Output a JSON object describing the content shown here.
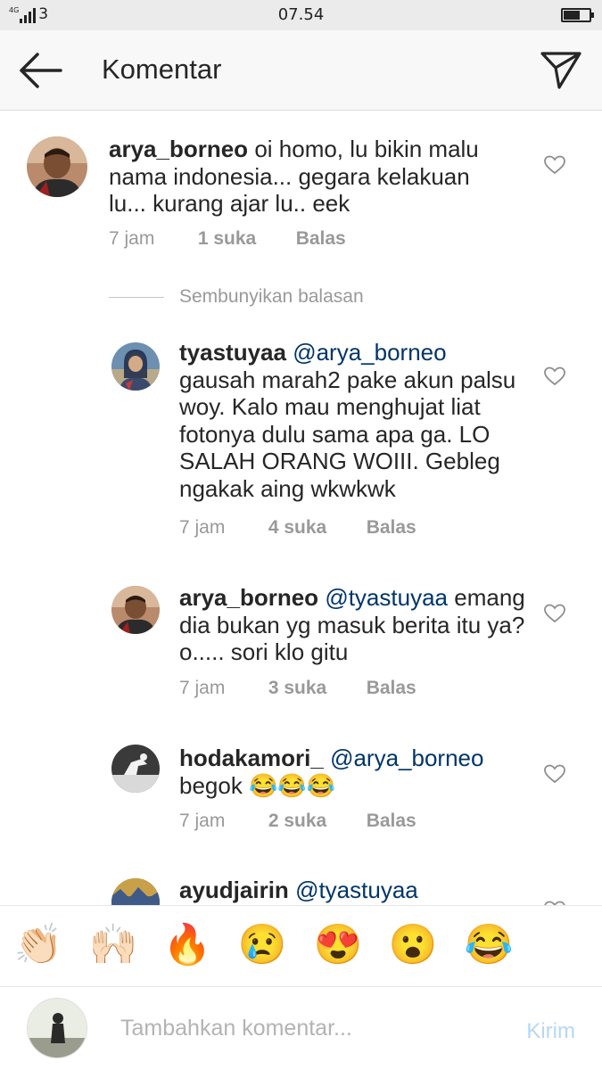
{
  "status_bar": {
    "network": "4G",
    "carrier_slot": "3",
    "time": "07.54"
  },
  "header": {
    "title": "Komentar",
    "back_icon": "arrow-left-icon",
    "send_icon": "paper-plane-icon"
  },
  "comments": [
    {
      "username": "arya_borneo",
      "mention": "",
      "text": "oi homo, lu bikin malu nama indonesia... gegara kelakuan lu... kurang ajar lu.. eek",
      "time": "7 jam",
      "likes": "1 suka",
      "reply": "Balas"
    }
  ],
  "hide_replies": "Sembunyikan balasan",
  "replies": [
    {
      "username": "tyastuyaa",
      "mention": "@arya_borneo",
      "text": "gausah marah2 pake akun palsu woy. Kalo mau menghujat liat fotonya dulu sama apa ga. LO SALAH ORANG WOIII. Gebleg ngakak aing wkwkwk",
      "time": "7 jam",
      "likes": "4 suka",
      "reply": "Balas"
    },
    {
      "username": "arya_borneo",
      "mention": "@tyastuyaa",
      "text": "emang dia bukan yg masuk berita itu ya? o..... sori klo gitu",
      "time": "7 jam",
      "likes": "3 suka",
      "reply": "Balas"
    },
    {
      "username": "hodakamori_",
      "mention": "@arya_borneo",
      "text": "begok 😂😂😂",
      "time": "7 jam",
      "likes": "2 suka",
      "reply": "Balas"
    },
    {
      "username": "ayudjairin",
      "mention": "@tyastuyaa",
      "text": "",
      "time": "",
      "likes": "",
      "reply": ""
    }
  ],
  "emoji_bar": [
    "👏🏻",
    "🙌🏻",
    "🔥",
    "😢",
    "😍",
    "😮",
    "😂"
  ],
  "composer": {
    "placeholder": "Tambahkan komentar...",
    "post_label": "Kirim"
  },
  "colors": {
    "mention": "#003569",
    "meta": "#999999",
    "post_disabled": "#b6d8f2",
    "header_bg": "#f8f8f8"
  }
}
